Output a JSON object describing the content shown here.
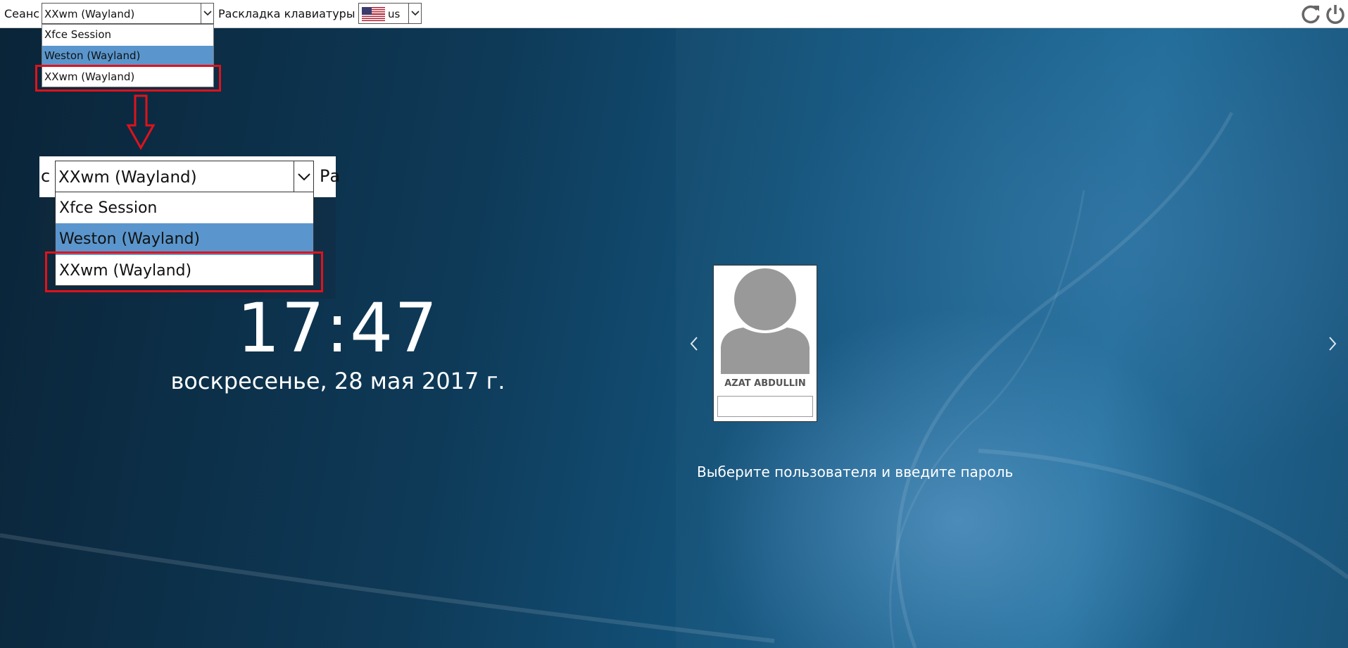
{
  "topbar": {
    "session_label": "Сеанс",
    "session_value": "XXwm (Wayland)",
    "layout_label": "Раскладка клавиатуры",
    "layout_value": "us",
    "icons": [
      "restart-icon",
      "power-icon"
    ]
  },
  "session_dropdown": {
    "options": [
      "Xfce Session",
      "Weston (Wayland)",
      "XXwm (Wayland)"
    ],
    "highlighted": "Weston (Wayland)"
  },
  "zoom_callout": {
    "left_fragment": "с",
    "right_fragment": "Ра",
    "combo_value": "XXwm (Wayland)",
    "options": [
      "Xfce Session",
      "Weston (Wayland)",
      "XXwm (Wayland)"
    ]
  },
  "clock": {
    "time": "17:47",
    "date": "воскресенье, 28 мая 2017 г."
  },
  "user": {
    "name": "AZAT ABDULLIN",
    "password_value": ""
  },
  "hint": "Выберите пользователя и введите пароль",
  "colors": {
    "highlight": "#5a96cd",
    "annotation_red": "#e0121b",
    "background": "#0e3a58"
  }
}
